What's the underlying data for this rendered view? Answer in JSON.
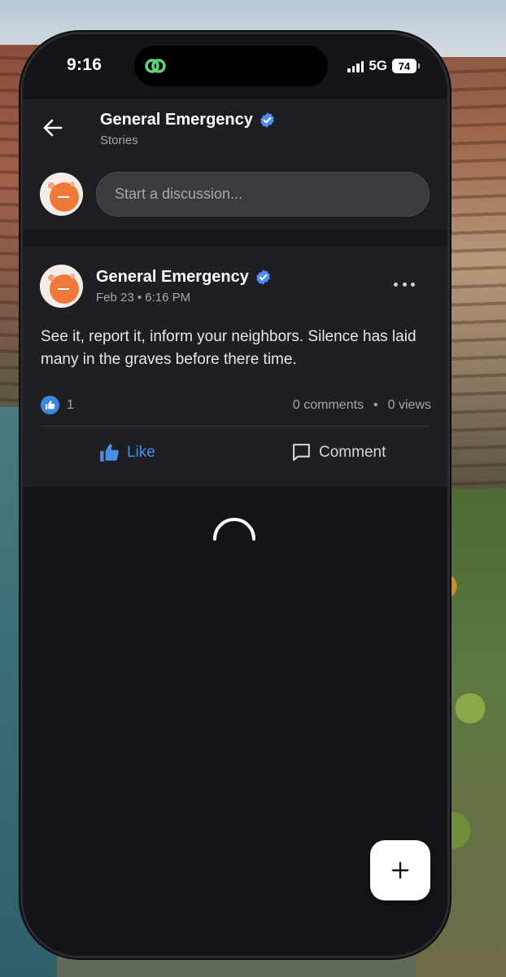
{
  "status_bar": {
    "time": "9:16",
    "network": "5G",
    "battery": "74",
    "island_icon": "link-rings-icon"
  },
  "header": {
    "title": "General Emergency",
    "subtitle": "Stories",
    "verified": true,
    "back_icon": "arrow-left-icon"
  },
  "composer": {
    "placeholder": "Start a discussion..."
  },
  "post": {
    "author": "General Emergency",
    "verified": true,
    "date": "Feb 23",
    "time": "6:16 PM",
    "body": "See it, report it, inform your neighbors. Silence has laid many in the graves before there time.",
    "reactions": "1",
    "comments": "0 comments",
    "views": "0 views",
    "like_label": "Like",
    "comment_label": "Comment"
  },
  "colors": {
    "accent": "#3a86e0",
    "like_text": "#4a8ee6",
    "background": "#131418",
    "card": "#1e1f23",
    "island_icon": "#5fd47a",
    "avatar": "#f0793a"
  },
  "fab": {
    "icon": "plus-icon"
  }
}
